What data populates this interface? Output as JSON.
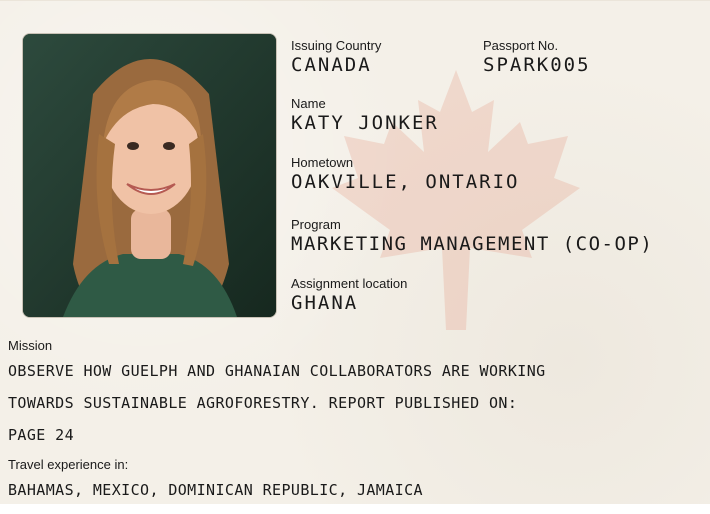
{
  "profile": {
    "issuing_country_label": "Issuing Country",
    "issuing_country": "CANADA",
    "passport_label": "Passport No.",
    "passport_no": "SPARK005",
    "name_label": "Name",
    "name": "KATY JONKER",
    "hometown_label": "Hometown",
    "hometown": "OAKVILLE, ONTARIO",
    "program_label": "Program",
    "program": "MARKETING MANAGEMENT (CO-OP)",
    "assignment_label": "Assignment location",
    "assignment": "GHANA"
  },
  "mission": {
    "label": "Mission",
    "lines": [
      "OBSERVE HOW GUELPH AND GHANAIAN COLLABORATORS ARE WORKING",
      "TOWARDS SUSTAINABLE AGROFORESTRY. REPORT PUBLISHED ON:",
      "PAGE 24"
    ]
  },
  "travel": {
    "label": "Travel experience in:",
    "value": "BAHAMAS, MEXICO, DOMINICAN REPUBLIC, JAMAICA"
  },
  "colors": {
    "background": "#f4f0e8",
    "leaf": "#e7a894",
    "text": "#1a1a1a"
  },
  "icons": {
    "watermark": "maple-leaf-icon"
  }
}
